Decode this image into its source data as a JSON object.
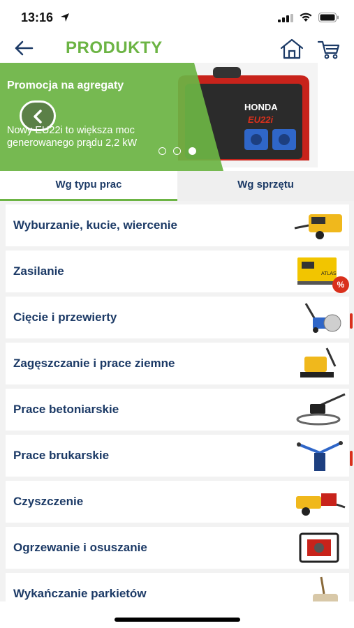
{
  "status_bar": {
    "time": "13:16"
  },
  "header": {
    "title": "PRODUKTY"
  },
  "banner": {
    "title": "Promocja na agregaty",
    "description": "Nowy EU22i to większa moc generowanego prądu 2,2 kW",
    "product_brand": "HONDA",
    "product_model": "EU22i",
    "active_slide": 3,
    "slide_count": 3,
    "colors": {
      "overlay": "#6cb444"
    }
  },
  "tabs": [
    {
      "label": "Wg typu prac",
      "active": true
    },
    {
      "label": "Wg sprzętu",
      "active": false
    }
  ],
  "categories": [
    {
      "label": "Wyburzanie, kucie, wiercenie",
      "icon": "air-compressor"
    },
    {
      "label": "Zasilanie",
      "icon": "power-generator",
      "badge": "%"
    },
    {
      "label": "Cięcie i przewierty",
      "icon": "floor-saw"
    },
    {
      "label": "Zagęszczanie i prace ziemne",
      "icon": "plate-compactor"
    },
    {
      "label": "Prace betoniarskie",
      "icon": "power-trowel"
    },
    {
      "label": "Prace brukarskie",
      "icon": "paving-clamp"
    },
    {
      "label": "Czyszczenie",
      "icon": "pressure-washer-trailer"
    },
    {
      "label": "Ogrzewanie i osuszanie",
      "icon": "water-pump"
    },
    {
      "label": "Wykańczanie parkietów",
      "icon": "floor-sander"
    }
  ],
  "colors": {
    "brand_green": "#6cb444",
    "text_navy": "#1c3a66",
    "accent_red": "#d9301c"
  }
}
